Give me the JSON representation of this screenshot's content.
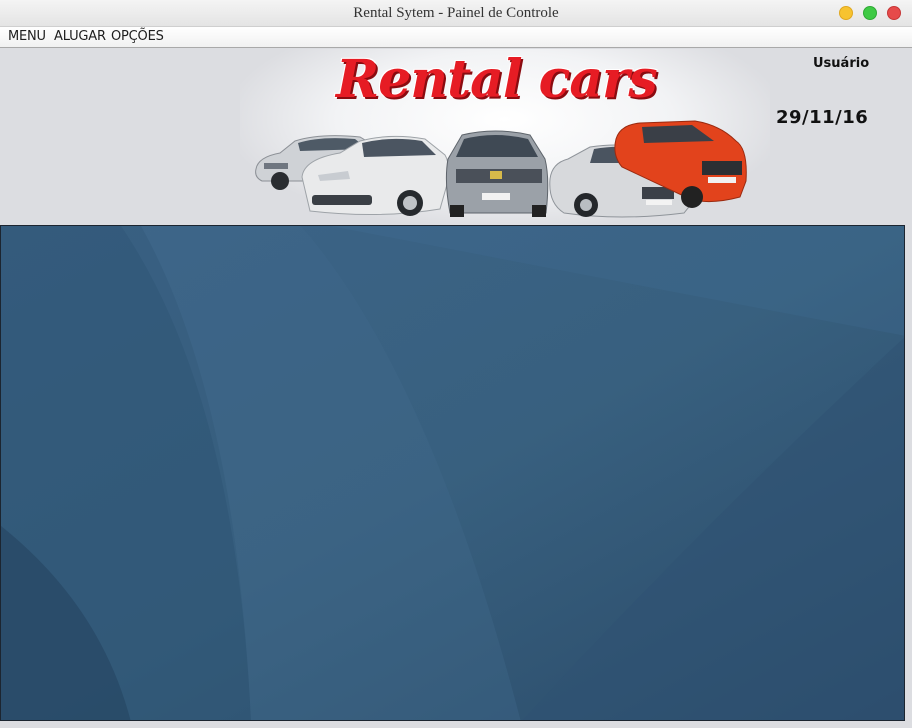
{
  "window": {
    "title": "Rental Sytem - Painel de Controle",
    "controls": [
      "minimize",
      "maximize",
      "close"
    ]
  },
  "menubar": {
    "items": [
      "MENU",
      "ALUGAR",
      "OPÇÕES"
    ]
  },
  "header": {
    "logo_text": "Rental cars",
    "user_label": "Usuário",
    "date": "29/11/16"
  },
  "colors": {
    "logo_red": "#e61c24",
    "desktop_blue": "#35597a",
    "chrome_gray": "#dcdde1"
  }
}
